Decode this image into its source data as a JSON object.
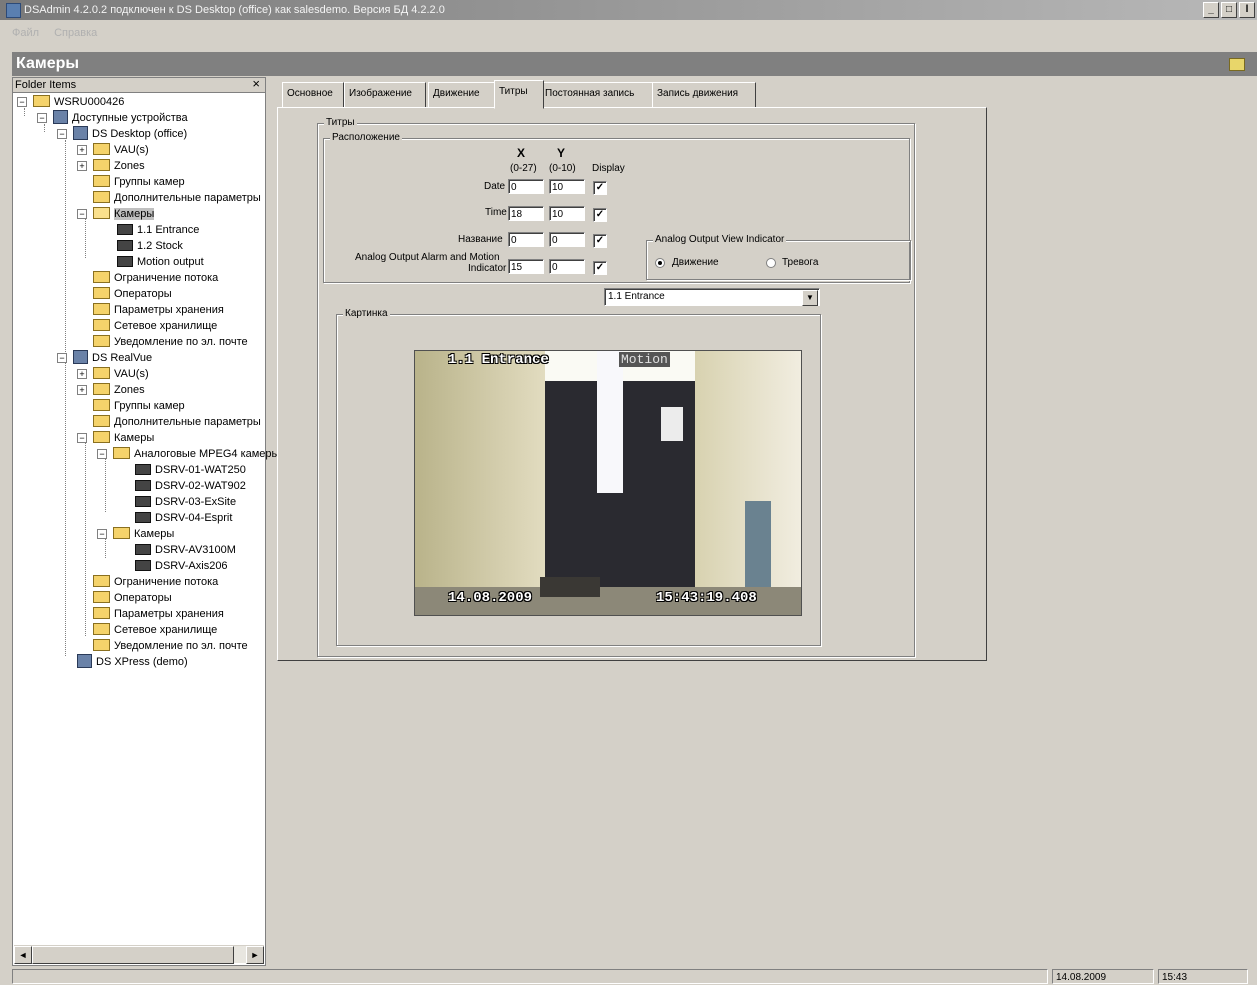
{
  "window": {
    "title": "DSAdmin 4.2.0.2  подключен к DS Desktop (office) как salesdemo. Версия БД 4.2.2.0",
    "min_glyph": "_",
    "max_glyph": "□",
    "close_glyph": "l"
  },
  "menu": [
    "Файл",
    "Справка"
  ],
  "section_title": "Камеры",
  "tree": {
    "header": "Folder Items",
    "close_glyph": "×",
    "nodes": [
      {
        "label": "WSRU000426"
      },
      {
        "label": "Доступные устройства"
      },
      {
        "label": "DS Desktop (office)"
      },
      {
        "label": "VAU(s)"
      },
      {
        "label": "Zones"
      },
      {
        "label": "Группы камер"
      },
      {
        "label": "Дополнительные параметры"
      },
      {
        "label": "Камеры"
      },
      {
        "label": "1.1 Entrance"
      },
      {
        "label": "1.2 Stock"
      },
      {
        "label": "Motion output"
      },
      {
        "label": "Ограничение потока"
      },
      {
        "label": "Операторы"
      },
      {
        "label": "Параметры хранения"
      },
      {
        "label": "Сетевое хранилище"
      },
      {
        "label": "Уведомление по эл. почте"
      },
      {
        "label": "DS RealVue"
      },
      {
        "label": "VAU(s)"
      },
      {
        "label": "Zones"
      },
      {
        "label": "Группы камер"
      },
      {
        "label": "Дополнительные параметры"
      },
      {
        "label": "Камеры"
      },
      {
        "label": "Аналоговые MPEG4 камеры"
      },
      {
        "label": "DSRV-01-WAT250"
      },
      {
        "label": "DSRV-02-WAT902"
      },
      {
        "label": "DSRV-03-ExSite"
      },
      {
        "label": "DSRV-04-Esprit"
      },
      {
        "label": "Камеры"
      },
      {
        "label": "DSRV-AV3100M"
      },
      {
        "label": "DSRV-Axis206"
      },
      {
        "label": "Ограничение потока"
      },
      {
        "label": "Операторы"
      },
      {
        "label": "Параметры хранения"
      },
      {
        "label": "Сетевое хранилище"
      },
      {
        "label": "Уведомление по эл. почте"
      },
      {
        "label": "DS XPress (demo)"
      }
    ]
  },
  "tabs": [
    "Основное",
    "Изображение",
    "Движение",
    "Титры",
    "Постоянная запись",
    "Запись движения"
  ],
  "titles_group": "Титры",
  "placement_group": "Расположение",
  "columns": {
    "x": "X",
    "y": "Y",
    "x_range": "(0-27)",
    "y_range": "(0-10)",
    "display": "Display"
  },
  "rows": [
    {
      "label": "Date",
      "x": "0",
      "y": "10",
      "checked": "✓"
    },
    {
      "label": "Time",
      "x": "18",
      "y": "10",
      "checked": "✓"
    },
    {
      "label": "Название",
      "x": "0",
      "y": "0",
      "checked": "✓"
    },
    {
      "label": "Analog Output Alarm and Motion",
      "label2": "Indicator",
      "x": "15",
      "y": "0",
      "checked": "✓"
    }
  ],
  "indicator": {
    "group": "Analog Output View Indicator",
    "option_motion": "Движение",
    "option_alarm": "Тревога",
    "selected": "motion"
  },
  "camera_select": {
    "value": "1.1 Entrance",
    "arrow": "▼"
  },
  "picture_group": "Картинка",
  "preview": {
    "camera_name": "1.1 Entrance",
    "motion": "Motion",
    "date": "14.08.2009",
    "time": "15:43:19.408"
  },
  "scroll": {
    "left": "◄",
    "right": "►"
  },
  "status": {
    "date": "14.08.2009",
    "time": "15:43"
  }
}
